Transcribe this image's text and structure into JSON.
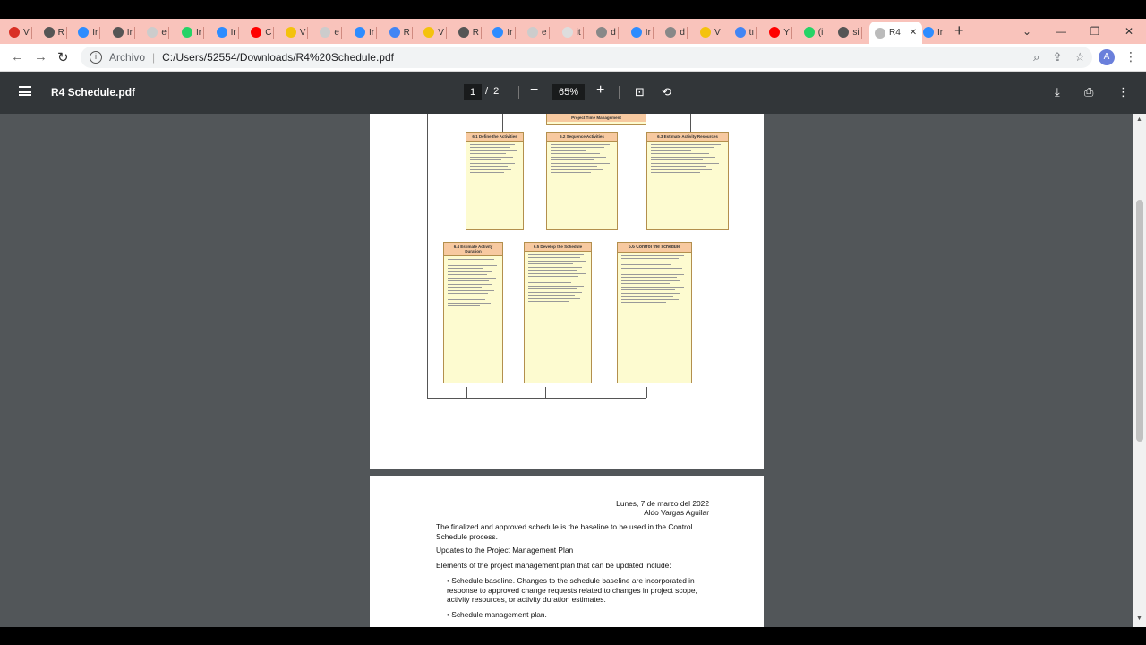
{
  "tabs": [
    {
      "label": "V",
      "color": "#d93025"
    },
    {
      "label": "R",
      "color": "#555"
    },
    {
      "label": "Ir",
      "color": "#2d8cff"
    },
    {
      "label": "Ir",
      "color": "#555"
    },
    {
      "label": "e",
      "color": "#ccc"
    },
    {
      "label": "Ir",
      "color": "#25d366"
    },
    {
      "label": "Ir",
      "color": "#2d8cff"
    },
    {
      "label": "C",
      "color": "#ff0000"
    },
    {
      "label": "V",
      "color": "#f4c20d"
    },
    {
      "label": "e",
      "color": "#ccc"
    },
    {
      "label": "Ir",
      "color": "#2d8cff"
    },
    {
      "label": "R",
      "color": "#4285f4"
    },
    {
      "label": "V",
      "color": "#f4c20d"
    },
    {
      "label": "R",
      "color": "#555"
    },
    {
      "label": "Ir",
      "color": "#2d8cff"
    },
    {
      "label": "e",
      "color": "#ccc"
    },
    {
      "label": "it",
      "color": "#ddd"
    },
    {
      "label": "d",
      "color": "#888"
    },
    {
      "label": "Ir",
      "color": "#2d8cff"
    },
    {
      "label": "d",
      "color": "#888"
    },
    {
      "label": "V",
      "color": "#f4c20d"
    },
    {
      "label": "tı",
      "color": "#4285f4"
    },
    {
      "label": "Y",
      "color": "#ff0000"
    },
    {
      "label": "(i",
      "color": "#25d366"
    },
    {
      "label": "si",
      "color": "#555"
    },
    {
      "label": "R4",
      "color": "#bbb",
      "active": true
    },
    {
      "label": "Ir",
      "color": "#2d8cff"
    }
  ],
  "address": {
    "scheme_label": "Archivo",
    "url": "C:/Users/52554/Downloads/R4%20Schedule.pdf",
    "avatar": "A"
  },
  "pdf": {
    "title": "R4 Schedule.pdf",
    "page": "1",
    "total": "2",
    "zoom": "65%"
  },
  "diagram": {
    "root": "Project Time Management",
    "boxes": [
      {
        "title": "6.1 Define the Activities"
      },
      {
        "title": "6.2 Sequence Activities"
      },
      {
        "title": "6.3 Estimate Activity Resources"
      },
      {
        "title": "6.4 Estimate Activity Duration"
      },
      {
        "title": "6.5 Develop the Schedule"
      },
      {
        "title": "6.6 Control the schedule"
      }
    ]
  },
  "page2": {
    "date": "Lunes, 7 de marzo del 2022",
    "author": "Aldo Vargas Aguilar",
    "p1": "The finalized and approved schedule is the baseline to be used in the Control Schedule process.",
    "p2": "Updates to the Project Management Plan",
    "p3": "Elements of the project management plan that can be updated include:",
    "b1": "• Schedule baseline. Changes to the schedule baseline are incorporated in response to approved change requests related to changes in project scope, activity resources, or activity duration estimates.",
    "b2": "• Schedule management plan."
  }
}
